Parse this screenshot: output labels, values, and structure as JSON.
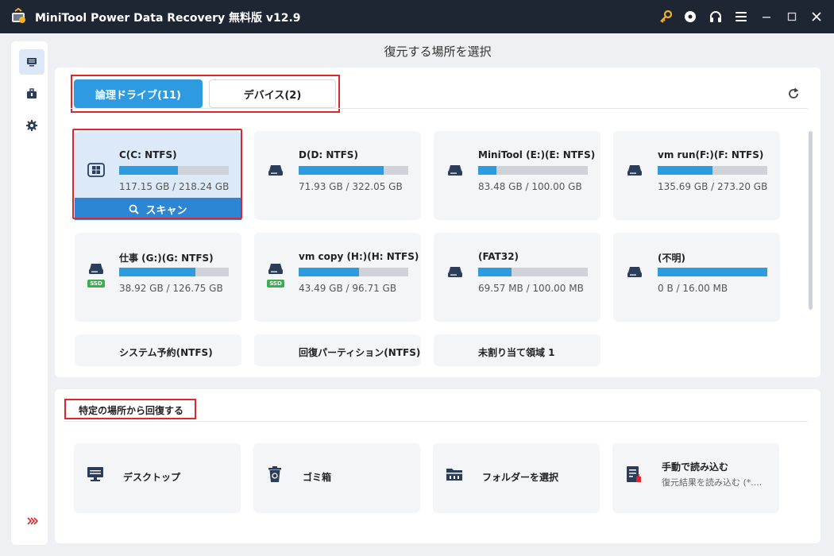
{
  "window": {
    "title": "MiniTool Power Data Recovery 無料版 v12.9",
    "controls": [
      "key-icon",
      "media-icon",
      "headset-icon",
      "menu-icon",
      "minimize-icon",
      "maximize-icon",
      "close-icon"
    ]
  },
  "sidebar": {
    "items": [
      {
        "name": "this-pc",
        "icon": "monitor-icon",
        "active": true
      },
      {
        "name": "toolbox",
        "icon": "toolbox-icon",
        "active": false
      },
      {
        "name": "settings",
        "icon": "gear-icon",
        "active": false
      }
    ],
    "expand_icon": "double-chevron-right-icon"
  },
  "page": {
    "heading": "復元する場所を選択"
  },
  "tabs": [
    {
      "label": "論理ドライブ(11)",
      "active": true
    },
    {
      "label": "デバイス(2)",
      "active": false
    }
  ],
  "drives": [
    {
      "name": "C(C: NTFS)",
      "size": "117.15 GB / 218.24 GB",
      "used_fraction": 0.537,
      "icon": "windows-drive-icon",
      "ssd": false,
      "selected": true
    },
    {
      "name": "D(D: NTFS)",
      "size": "71.93 GB / 322.05 GB",
      "used_fraction": 0.777,
      "icon": "drive-icon",
      "ssd": false
    },
    {
      "name": "MiniTool (E:)(E: NTFS)",
      "size": "83.48 GB / 100.00 GB",
      "used_fraction": 0.165,
      "icon": "drive-icon",
      "ssd": false
    },
    {
      "name": "vm run(F:)(F: NTFS)",
      "size": "135.69 GB / 273.20 GB",
      "used_fraction": 0.503,
      "icon": "drive-icon",
      "ssd": false
    },
    {
      "name": "仕事 (G:)(G: NTFS)",
      "size": "38.92 GB / 126.75 GB",
      "used_fraction": 0.693,
      "icon": "drive-icon",
      "ssd": true
    },
    {
      "name": "vm copy (H:)(H: NTFS)",
      "size": "43.49 GB / 96.71 GB",
      "used_fraction": 0.55,
      "icon": "drive-icon",
      "ssd": true
    },
    {
      "name": "(FAT32)",
      "size": "69.57 MB / 100.00 MB",
      "used_fraction": 0.304,
      "icon": "drive-icon",
      "ssd": false
    },
    {
      "name": "(不明)",
      "size": "0 B / 16.00 MB",
      "used_fraction": 1.0,
      "icon": "drive-icon",
      "ssd": false
    },
    {
      "name": "システム予約(NTFS)",
      "partial": true
    },
    {
      "name": "回復パーティション(NTFS)",
      "partial": true
    },
    {
      "name": "未割り当て領域 1",
      "partial": true
    }
  ],
  "ssd_badge": "SSD",
  "scan_button": {
    "label": "スキャン"
  },
  "specific_locations": {
    "heading": "特定の場所から回復する",
    "items": [
      {
        "label": "デスクトップ",
        "icon": "desktop-icon"
      },
      {
        "label": "ゴミ箱",
        "icon": "recycle-bin-icon"
      },
      {
        "label": "フォルダーを選択",
        "icon": "folder-icon"
      },
      {
        "label": "手動で読み込む",
        "sublabel": "復元結果を読み込む (*....",
        "icon": "manual-load-icon"
      }
    ]
  },
  "colors": {
    "titlebar": "#1e2533",
    "accent": "#2e9be0",
    "scan_button": "#2c86d3",
    "highlight_outline": "#e0262b",
    "ssd_badge": "#3cae4f",
    "key_icon": "#f5b324"
  }
}
